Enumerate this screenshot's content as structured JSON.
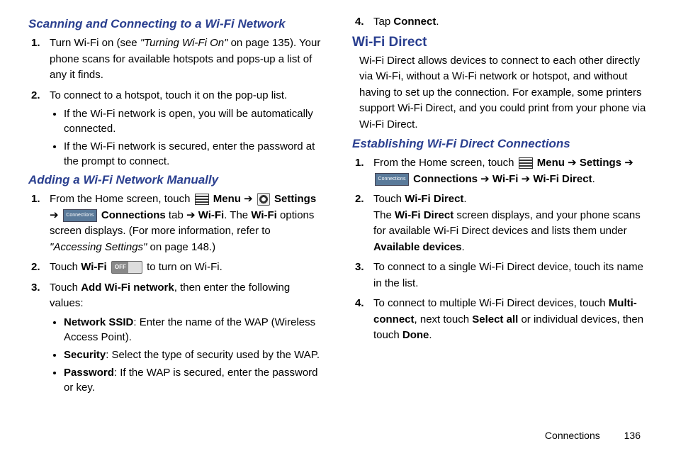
{
  "left": {
    "h1": "Scanning and Connecting to a Wi-Fi Network",
    "s1_1a": "Turn Wi-Fi on (see ",
    "s1_1b": "\"Turning Wi-Fi On\"",
    "s1_1c": " on page 135). Your phone scans for available hotspots and pops-up a list of any it finds.",
    "s1_2": "To connect to a hotspot, touch it on the pop-up list.",
    "s1_2b1": "If the Wi-Fi network is open, you will be automatically connected.",
    "s1_2b2": "If the Wi-Fi network is secured, enter the password at the prompt to connect.",
    "h2": "Adding a Wi-Fi Network Manually",
    "s2_1a": "From the Home screen, touch ",
    "s2_1_menu": "Menu",
    "s2_1_arrow1": " ➔ ",
    "s2_1_settings": "Settings",
    "s2_1_arrow2": " ➔ ",
    "s2_1_conn": "Connections",
    "s2_1_tab": " tab ➔ ",
    "s2_1_wifi": "Wi-Fi",
    "s2_1_c": ". The ",
    "s2_1_wifi2": "Wi-Fi",
    "s2_1_d": " options screen displays. (For more information, refer to ",
    "s2_1_ref": "\"Accessing Settings\"",
    "s2_1_e": " on page 148.)",
    "s2_2a": "Touch ",
    "s2_2_wifi": "Wi-Fi",
    "s2_2b": " to turn on Wi-Fi.",
    "s2_3a": "Touch ",
    "s2_3_add": "Add Wi-Fi network",
    "s2_3b": ", then enter the following values:",
    "s2_3b1a": "Network SSID",
    "s2_3b1b": ": Enter the name of the WAP (Wireless Access Point).",
    "s2_3b2a": "Security",
    "s2_3b2b": ": Select the type of security used by the WAP.",
    "s2_3b3a": "Password",
    "s2_3b3b": ": If the WAP is secured, enter the password or key."
  },
  "right": {
    "s0_4a": "Tap ",
    "s0_4_connect": "Connect",
    "s0_4b": ".",
    "h1": "Wi-Fi Direct",
    "intro": "Wi-Fi Direct allows devices to connect to each other directly via Wi-Fi, without a Wi-Fi network or hotspot, and without having to set up the connection. For example, some printers support Wi-Fi Direct, and you could print from your phone via Wi-Fi Direct.",
    "h2": "Establishing Wi-Fi Direct Connections",
    "s2_1a": "From the Home screen, touch ",
    "s2_1_menu": "Menu",
    "s2_1_arrow1": " ➔ ",
    "s2_1_settings": "Settings",
    "s2_1_arrow2": " ➔ ",
    "s2_1_conn": "Connections",
    "s2_1_arrow3": " ➔ ",
    "s2_1_wifi": "Wi-Fi",
    "s2_1_arrow4": " ➔ ",
    "s2_1_wifid": "Wi-Fi Direct",
    "s2_1_end": ".",
    "s2_2a": "Touch ",
    "s2_2_wifid": "Wi-Fi Direct",
    "s2_2b": ".",
    "s2_2c": "The ",
    "s2_2_wifid2": "Wi-Fi Direct",
    "s2_2d": " screen displays, and your phone scans for available Wi-Fi Direct devices and lists them under ",
    "s2_2_avail": "Available devices",
    "s2_2e": ".",
    "s2_3": "To connect to a single Wi-Fi Direct device, touch its name in the list.",
    "s2_4a": "To connect to multiple Wi-Fi Direct devices, touch ",
    "s2_4_multi": "Multi-connect",
    "s2_4b": ", next touch ",
    "s2_4_sel": "Select all",
    "s2_4c": " or individual devices, then touch ",
    "s2_4_done": "Done",
    "s2_4d": "."
  },
  "footer": {
    "section": "Connections",
    "page": "136"
  },
  "icons": {
    "connections_label": "Connections",
    "off_label": "OFF"
  }
}
